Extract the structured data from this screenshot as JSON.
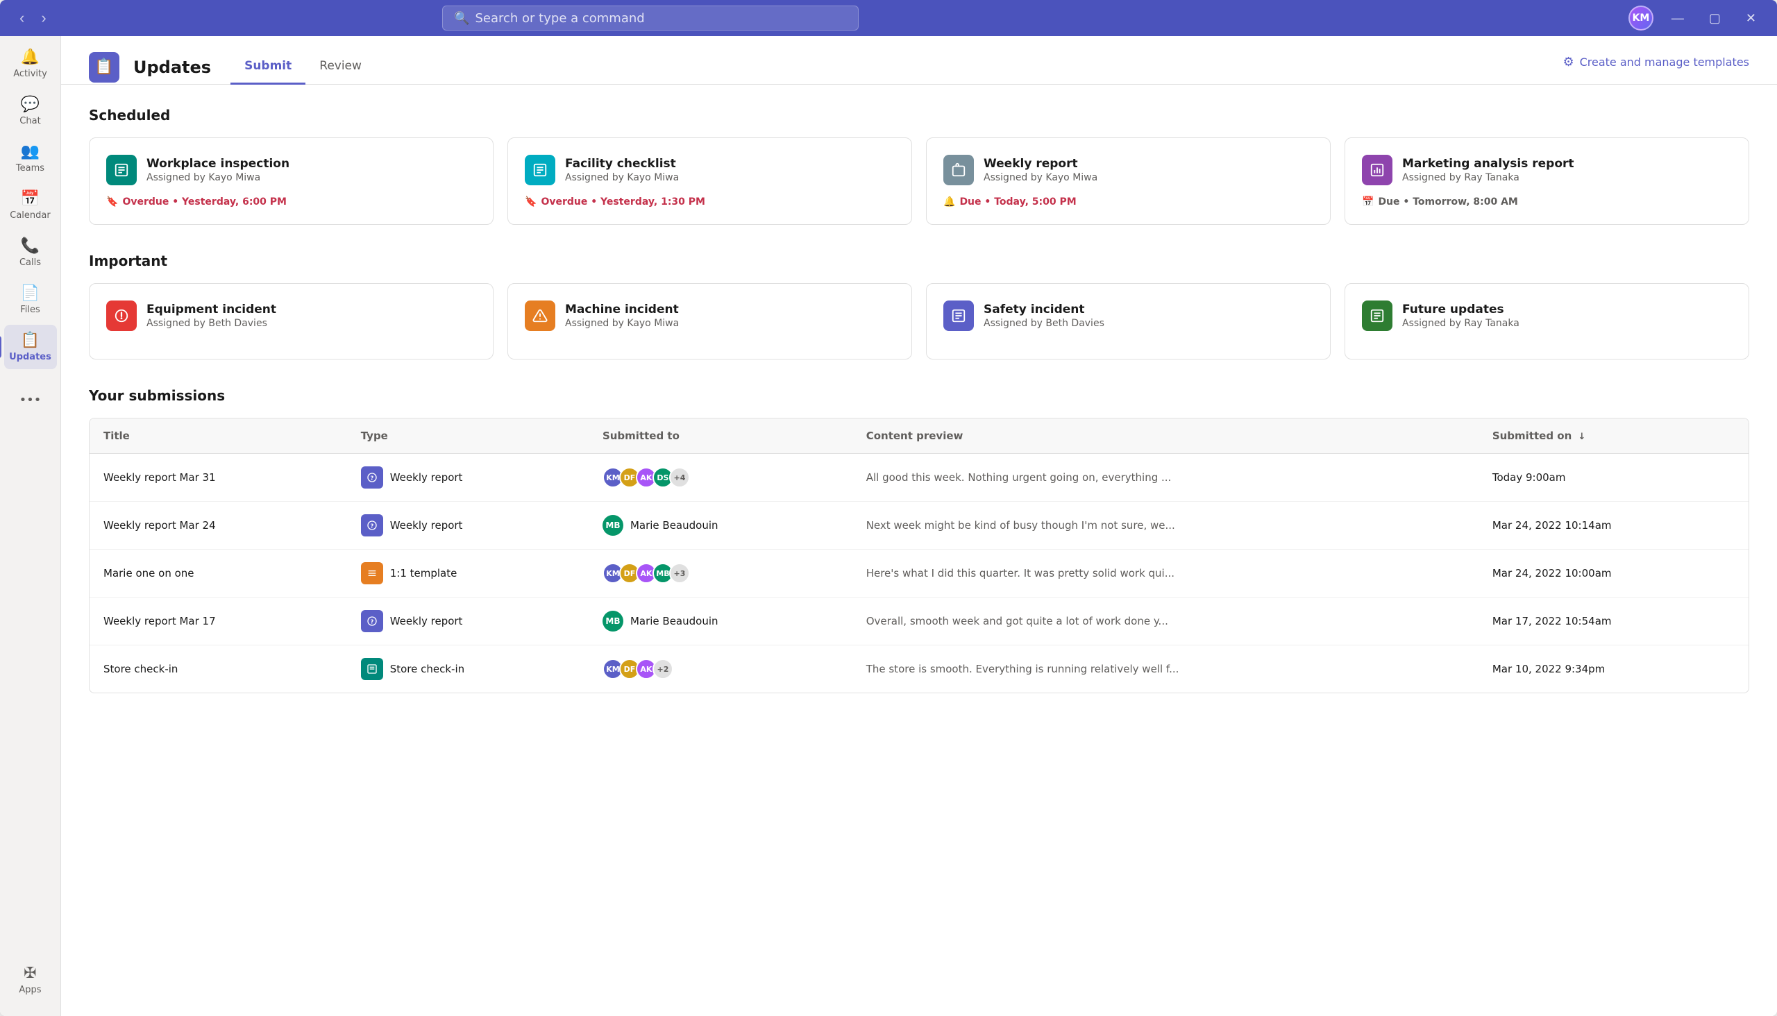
{
  "titlebar": {
    "search_placeholder": "Search or type a command",
    "back_btn": "‹",
    "forward_btn": "›",
    "minimize": "—",
    "maximize": "☐",
    "close": "✕",
    "avatar_initials": "KM"
  },
  "sidebar": {
    "items": [
      {
        "id": "activity",
        "label": "Activity",
        "icon": "🔔"
      },
      {
        "id": "chat",
        "label": "Chat",
        "icon": "💬"
      },
      {
        "id": "teams",
        "label": "Teams",
        "icon": "👥"
      },
      {
        "id": "calendar",
        "label": "Calendar",
        "icon": "📅"
      },
      {
        "id": "calls",
        "label": "Calls",
        "icon": "📞"
      },
      {
        "id": "files",
        "label": "Files",
        "icon": "📄"
      },
      {
        "id": "updates",
        "label": "Updates",
        "icon": "📋",
        "active": true
      }
    ],
    "more_label": "•••",
    "apps_label": "Apps",
    "apps_icon": "⊞"
  },
  "app_header": {
    "icon": "📋",
    "title": "Updates",
    "tabs": [
      {
        "id": "submit",
        "label": "Submit",
        "active": true
      },
      {
        "id": "review",
        "label": "Review",
        "active": false
      }
    ],
    "action_label": "Create and manage templates",
    "action_icon": "⚙"
  },
  "scheduled_section": {
    "title": "Scheduled",
    "cards": [
      {
        "id": "workplace-inspection",
        "icon": "📋",
        "icon_class": "teal",
        "title": "Workplace inspection",
        "assigned_by": "Assigned by Kayo Miwa",
        "status": "Overdue • Yesterday, 6:00 PM",
        "status_class": "overdue",
        "status_icon": "🔖"
      },
      {
        "id": "facility-checklist",
        "icon": "📋",
        "icon_class": "teal2",
        "title": "Facility checklist",
        "assigned_by": "Assigned by Kayo Miwa",
        "status": "Overdue • Yesterday, 1:30 PM",
        "status_class": "overdue",
        "status_icon": "🔖"
      },
      {
        "id": "weekly-report",
        "icon": "🗑",
        "icon_class": "blue-gray",
        "title": "Weekly report",
        "assigned_by": "Assigned by Kayo Miwa",
        "status": "Due • Today, 5:00 PM",
        "status_class": "due-today",
        "status_icon": "🔔"
      },
      {
        "id": "marketing-analysis",
        "icon": "📊",
        "icon_class": "purple",
        "title": "Marketing analysis report",
        "assigned_by": "Assigned by Ray Tanaka",
        "status": "Due • Tomorrow, 8:00 AM",
        "status_class": "due-tomorrow",
        "status_icon": "📅"
      }
    ]
  },
  "important_section": {
    "title": "Important",
    "cards": [
      {
        "id": "equipment-incident",
        "icon": "🚨",
        "icon_class": "red",
        "title": "Equipment incident",
        "assigned_by": "Assigned by Beth Davies"
      },
      {
        "id": "machine-incident",
        "icon": "⚠",
        "icon_class": "orange",
        "title": "Machine incident",
        "assigned_by": "Assigned by Kayo Miwa"
      },
      {
        "id": "safety-incident",
        "icon": "📋",
        "icon_class": "indigo",
        "title": "Safety incident",
        "assigned_by": "Assigned by Beth Davies"
      },
      {
        "id": "future-updates",
        "icon": "📋",
        "icon_class": "green",
        "title": "Future updates",
        "assigned_by": "Assigned by Ray Tanaka"
      }
    ]
  },
  "submissions_section": {
    "title": "Your submissions",
    "columns": {
      "title": "Title",
      "type": "Type",
      "submitted_to": "Submitted to",
      "content_preview": "Content preview",
      "submitted_on": "Submitted on"
    },
    "rows": [
      {
        "id": "row1",
        "title": "Weekly report Mar 31",
        "type_label": "Weekly report",
        "type_icon_class": "blue",
        "type_icon": "?",
        "avatars": [
          {
            "initials": "KM",
            "class": "a1"
          },
          {
            "initials": "DF",
            "class": "a2"
          },
          {
            "initials": "AK",
            "class": "a3"
          },
          {
            "initials": "DS",
            "class": "a4"
          },
          {
            "initials": "+4",
            "class": "plus"
          }
        ],
        "preview": "All good this week. Nothing urgent going on, everything ...",
        "submitted_on": "Today 9:00am"
      },
      {
        "id": "row2",
        "title": "Weekly report Mar 24",
        "type_label": "Weekly report",
        "type_icon_class": "blue",
        "type_icon": "?",
        "single_avatar": true,
        "avatar_initials": "MB",
        "avatar_class": "mb",
        "avatar_name": "Marie Beaudouin",
        "preview": "Next week might be kind of busy though I'm not sure, we...",
        "submitted_on": "Mar 24, 2022 10:14am"
      },
      {
        "id": "row3",
        "title": "Marie one on one",
        "type_label": "1:1 template",
        "type_icon_class": "orange",
        "type_icon": "≡",
        "avatars": [
          {
            "initials": "KM",
            "class": "a1"
          },
          {
            "initials": "DF",
            "class": "a2"
          },
          {
            "initials": "AK",
            "class": "a3"
          },
          {
            "initials": "MB",
            "class": "a4"
          },
          {
            "initials": "+3",
            "class": "plus"
          }
        ],
        "preview": "Here's what I did this quarter. It was pretty solid work qui...",
        "submitted_on": "Mar 24, 2022 10:00am"
      },
      {
        "id": "row4",
        "title": "Weekly report Mar 17",
        "type_label": "Weekly report",
        "type_icon_class": "blue",
        "type_icon": "?",
        "single_avatar": true,
        "avatar_initials": "MB",
        "avatar_class": "mb",
        "avatar_name": "Marie Beaudouin",
        "preview": "Overall, smooth week and got quite a lot of work done y...",
        "submitted_on": "Mar 17, 2022 10:54am"
      },
      {
        "id": "row5",
        "title": "Store check-in",
        "type_label": "Store check-in",
        "type_icon_class": "teal",
        "type_icon": "☰",
        "avatars": [
          {
            "initials": "KM",
            "class": "a1"
          },
          {
            "initials": "DF",
            "class": "a2"
          },
          {
            "initials": "AK",
            "class": "a3"
          },
          {
            "initials": "+2",
            "class": "plus"
          }
        ],
        "preview": "The store is smooth. Everything is running relatively well f...",
        "submitted_on": "Mar 10, 2022 9:34pm"
      }
    ]
  }
}
